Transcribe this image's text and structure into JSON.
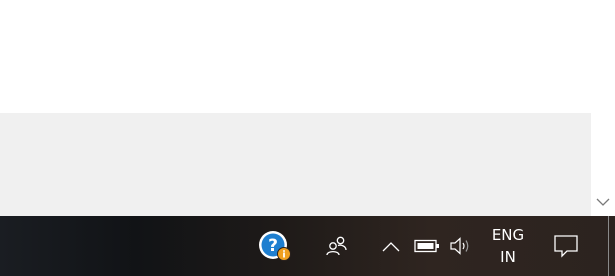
{
  "taskbar": {
    "tray": {
      "language_line1": "ENG",
      "language_line2": "IN"
    }
  },
  "icons": {
    "scroll_down": "chevron-down-icon",
    "help_app": "help-question-icon",
    "people": "people-icon",
    "show_hidden": "chevron-up-icon",
    "battery": "battery-icon",
    "volume": "speaker-icon",
    "notifications": "action-center-icon"
  },
  "colors": {
    "taskbar_bg": "#2a221e",
    "content_gray": "#f0f0f0",
    "help_icon_blue": "#1e7fd0",
    "badge_orange": "#f0a020"
  }
}
